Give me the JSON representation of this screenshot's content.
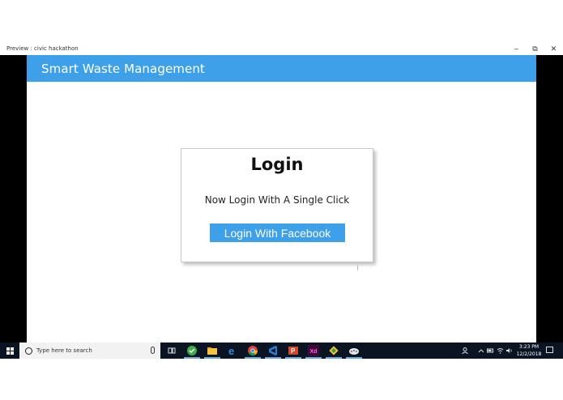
{
  "window": {
    "title": "Preview : civic hackathon",
    "minimize_glyph": "–",
    "restore_glyph": "⧉",
    "close_glyph": "✕"
  },
  "app": {
    "brand": "Smart Waste Management",
    "header_color": "#3ea0e8"
  },
  "login": {
    "heading": "Login",
    "subtext": "Now Login With A Single Click",
    "facebook_button": "Login With Facebook"
  },
  "taskbar": {
    "search_placeholder": "Type here to search",
    "pinned": [
      {
        "icon": "task-view-icon"
      },
      {
        "icon": "green-app-icon"
      },
      {
        "icon": "file-explorer-icon"
      },
      {
        "icon": "edge-icon"
      },
      {
        "icon": "chrome-icon"
      },
      {
        "icon": "visual-studio-icon"
      },
      {
        "icon": "powerpoint-icon"
      },
      {
        "icon": "xd-icon"
      },
      {
        "icon": "git-icon"
      },
      {
        "icon": "paint-icon"
      }
    ],
    "time": "3:23 PM",
    "date": "12/2/2018"
  }
}
